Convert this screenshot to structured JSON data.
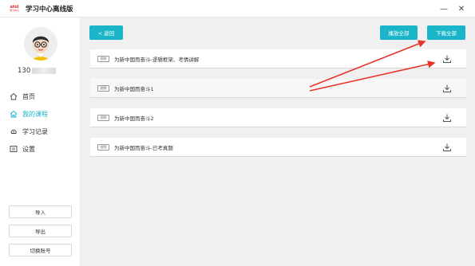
{
  "window": {
    "logo_line1": "ahtd",
    "logo_line2": "学习中心",
    "title": "学习中心离线版",
    "minimize": "—",
    "close": "✕"
  },
  "sidebar": {
    "phone_prefix": "130",
    "nav": [
      {
        "label": "首页",
        "icon": "home-icon"
      },
      {
        "label": "我的课程",
        "icon": "course-icon",
        "active": true
      },
      {
        "label": "学习记录",
        "icon": "history-icon"
      },
      {
        "label": "设置",
        "icon": "settings-icon"
      }
    ],
    "import_label": "导入",
    "export_label": "导出",
    "switch_label": "切换账号"
  },
  "main": {
    "back_label": "< 返回",
    "play_all_label": "播放全部",
    "download_all_label": "下载全部",
    "courses": [
      {
        "tag": "视频",
        "title": "为新中国而奋斗-逻辑框架、考情讲解"
      },
      {
        "tag": "视频",
        "title": "为新中国而奋斗1"
      },
      {
        "tag": "视频",
        "title": "为新中国而奋斗2"
      },
      {
        "tag": "视频",
        "title": "为新中国而奋斗-已考真题"
      }
    ]
  },
  "colors": {
    "accent": "#1ab5c8",
    "annotation": "#e8352b",
    "background": "#f0f0f0"
  }
}
